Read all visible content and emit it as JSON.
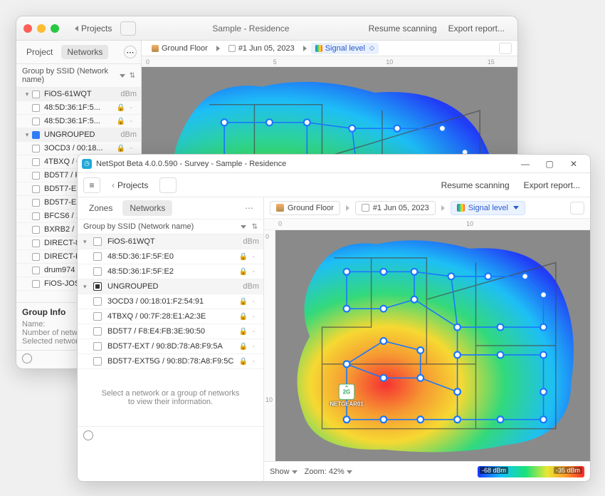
{
  "mac": {
    "projects_back": "Projects",
    "title": "Sample - Residence",
    "resume": "Resume scanning",
    "export": "Export report...",
    "tab_project": "Project",
    "tab_networks": "Networks",
    "group_by": "Group by SSID (Network name)",
    "crumb_floor": "Ground Floor",
    "crumb_date": "#1 Jun 05, 2023",
    "crumb_signal": "Signal level",
    "ruler": {
      "r0": "0",
      "r5": "5",
      "r10": "10",
      "r15": "15"
    },
    "groups": [
      {
        "name": "FiOS-61WQT",
        "unit": "dBm",
        "open": true,
        "color": "",
        "rows": [
          {
            "name": "48:5D:36:1F:5...",
            "lock": true
          },
          {
            "name": "48:5D:36:1F:5...",
            "lock": true
          }
        ]
      },
      {
        "name": "UNGROUPED",
        "unit": "dBm",
        "open": true,
        "color": "blu",
        "rows": [
          {
            "name": "3OCD3 / 00:18...",
            "lock": true
          },
          {
            "name": "4TBXQ / 00:7F:...",
            "lock": true
          },
          {
            "name": "BD5T7 / F8:E4:...",
            "lock": true
          },
          {
            "name": "BD5T7-EXT / 9...",
            "lock": true
          },
          {
            "name": "BD5T7-EXT...",
            "lock": false
          },
          {
            "name": "BFCS6 / 18...",
            "lock": false
          },
          {
            "name": "BXRB2 / 18...",
            "lock": false
          },
          {
            "name": "DIRECT-81...",
            "lock": false
          },
          {
            "name": "DIRECT-KT...",
            "lock": false
          },
          {
            "name": "drum974 / ...",
            "lock": true
          },
          {
            "name": "FiOS-JOSM...",
            "lock": false
          }
        ]
      }
    ],
    "info_title": "Group Info",
    "info_name": "Name:",
    "info_num": "Number of networks:",
    "info_sel": "Selected networks:"
  },
  "win": {
    "title": "NetSpot Beta 4.0.0.590 - Survey - Sample - Residence",
    "projects_back": "Projects",
    "resume": "Resume scanning",
    "export": "Export report...",
    "tab_zones": "Zones",
    "tab_networks": "Networks",
    "group_by": "Group by SSID (Network name)",
    "crumb_floor": "Ground Floor",
    "crumb_date": "#1 Jun 05, 2023",
    "crumb_signal": "Signal level",
    "ruler": {
      "r0": "0",
      "r10": "10"
    },
    "groups": [
      {
        "name": "FiOS-61WQT",
        "unit": "dBm",
        "open": true,
        "fill": false,
        "rows": [
          {
            "name": "48:5D:36:1F:5F:E0",
            "lock": true
          },
          {
            "name": "48:5D:36:1F:5F:E2",
            "lock": true
          }
        ]
      },
      {
        "name": "UNGROUPED",
        "unit": "dBm",
        "open": true,
        "fill": true,
        "rows": [
          {
            "name": "3OCD3 / 00:18:01:F2:54:91",
            "lock": true
          },
          {
            "name": "4TBXQ / 00:7F:28:E1:A2:3E",
            "lock": true
          },
          {
            "name": "BD5T7 / F8:E4:FB:3E:90:50",
            "lock": true
          },
          {
            "name": "BD5T7-EXT / 90:8D:78:A8:F9:5A",
            "lock": true
          },
          {
            "name": "BD5T7-EXT5G / 90:8D:78:A8:F9:5C",
            "lock": true
          }
        ]
      }
    ],
    "hint": "Select a network or a group of networks to view their information.",
    "show": "Show",
    "zoom": "Zoom: 42%",
    "legend_min": "-68 dBm",
    "legend_max": "-35 dBm",
    "ap_label": "NETGEAR01",
    "ap_band": "2G"
  }
}
